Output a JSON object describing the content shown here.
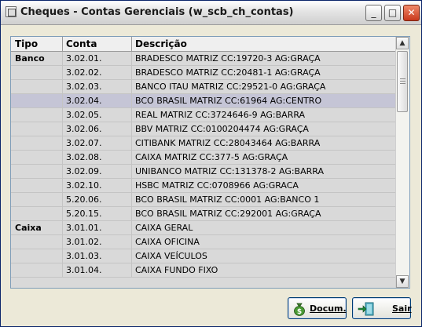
{
  "window": {
    "title": "Cheques - Contas Gerenciais (w_scb_ch_contas)",
    "minimize_glyph": "_",
    "maximize_glyph": "□",
    "close_glyph": "✕"
  },
  "grid": {
    "columns": [
      "Tipo",
      "Conta",
      "Descrição"
    ],
    "selected_row_index": 3,
    "rows": [
      {
        "tipo": "Banco",
        "conta": "3.02.01.",
        "descricao": "BRADESCO  MATRIZ    CC:19720-3   AG:GRAÇA"
      },
      {
        "tipo": "",
        "conta": "3.02.02.",
        "descricao": "BRADESCO  MATRIZ    CC:20481-1   AG:GRAÇA"
      },
      {
        "tipo": "",
        "conta": "3.02.03.",
        "descricao": "BANCO ITAU MATRIZ    CC:29521-0    AG:GRAÇA"
      },
      {
        "tipo": "",
        "conta": "3.02.04.",
        "descricao": "BCO BRASIL MATRIZ   CC:61964    AG:CENTRO"
      },
      {
        "tipo": "",
        "conta": "3.02.05.",
        "descricao": "REAL       MATRIZ    CC:3724646-9  AG:BARRA"
      },
      {
        "tipo": "",
        "conta": "3.02.06.",
        "descricao": "BBV        MATRIZ   CC:0100204474 AG:GRAÇA"
      },
      {
        "tipo": "",
        "conta": "3.02.07.",
        "descricao": "CITIBANK  MATRIZ    CC:28043464  AG:BARRA"
      },
      {
        "tipo": "",
        "conta": "3.02.08.",
        "descricao": "CAIXA      MATRIZ    CC:377-5      AG:GRAÇA"
      },
      {
        "tipo": "",
        "conta": "3.02.09.",
        "descricao": "UNIBANCO  MATRIZ   CC:131378-2  AG:BARRA"
      },
      {
        "tipo": "",
        "conta": "3.02.10.",
        "descricao": "HSBC       MATRIZ    CC:0708966   AG:GRACA"
      },
      {
        "tipo": "",
        "conta": "5.20.06.",
        "descricao": "BCO BRASIL MATRIZ    CC:0001       AG:BANCO 1"
      },
      {
        "tipo": "",
        "conta": "5.20.15.",
        "descricao": "BCO BRASIL MATRIZ    CC:292001    AG:GRAÇA"
      },
      {
        "tipo": "Caixa",
        "conta": "3.01.01.",
        "descricao": "CAIXA GERAL"
      },
      {
        "tipo": "",
        "conta": "3.01.02.",
        "descricao": "CAIXA OFICINA"
      },
      {
        "tipo": "",
        "conta": "3.01.03.",
        "descricao": "CAIXA VEÍCULOS"
      },
      {
        "tipo": "",
        "conta": "3.01.04.",
        "descricao": "CAIXA FUNDO FIXO"
      }
    ]
  },
  "buttons": {
    "docum_label": "Docum.",
    "sair_label": "Sair"
  }
}
